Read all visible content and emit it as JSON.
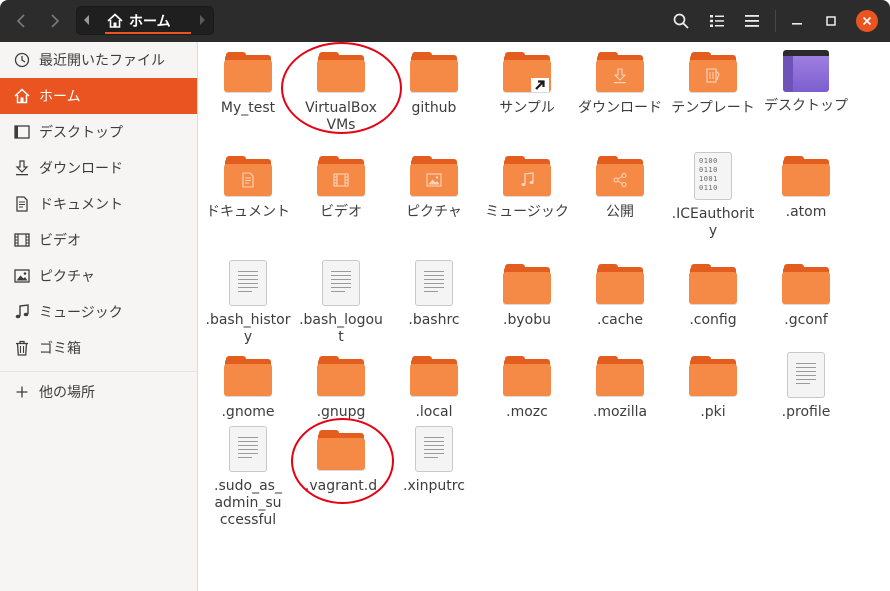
{
  "header": {
    "back_icon": "chevron-left-icon",
    "forward_icon": "chevron-right-icon",
    "path_current": "ホーム",
    "search_icon": "search-icon",
    "view_icon": "list-view-icon",
    "menu_icon": "hamburger-menu-icon",
    "accent_color": "#e95420"
  },
  "sidebar": {
    "items": [
      {
        "label": "最近開いたファイル",
        "icon": "clock-icon"
      },
      {
        "label": "ホーム",
        "icon": "home-icon",
        "active": true
      },
      {
        "label": "デスクトップ",
        "icon": "desktop-icon"
      },
      {
        "label": "ダウンロード",
        "icon": "download-icon"
      },
      {
        "label": "ドキュメント",
        "icon": "document-icon"
      },
      {
        "label": "ビデオ",
        "icon": "video-icon"
      },
      {
        "label": "ピクチャ",
        "icon": "picture-icon"
      },
      {
        "label": "ミュージック",
        "icon": "music-icon"
      },
      {
        "label": "ゴミ箱",
        "icon": "trash-icon"
      },
      {
        "label": "他の場所",
        "icon": "plus-icon"
      }
    ]
  },
  "files": [
    {
      "name": "My_test",
      "type": "folder"
    },
    {
      "name": "VirtualBox VMs",
      "type": "folder"
    },
    {
      "name": "github",
      "type": "folder"
    },
    {
      "name": "サンプル",
      "type": "folder-link"
    },
    {
      "name": "ダウンロード",
      "type": "folder-download"
    },
    {
      "name": "テンプレート",
      "type": "folder-template"
    },
    {
      "name": "デスクトップ",
      "type": "desktop"
    },
    {
      "name": "ドキュメント",
      "type": "folder-document"
    },
    {
      "name": "ビデオ",
      "type": "folder-video"
    },
    {
      "name": "ピクチャ",
      "type": "folder-picture"
    },
    {
      "name": "ミュージック",
      "type": "folder-music"
    },
    {
      "name": "公開",
      "type": "folder-share"
    },
    {
      "name": ".ICEauthority",
      "type": "binary"
    },
    {
      "name": ".atom",
      "type": "folder"
    },
    {
      "name": ".bash_history",
      "type": "text"
    },
    {
      "name": ".bash_logout",
      "type": "text"
    },
    {
      "name": ".bashrc",
      "type": "text"
    },
    {
      "name": ".byobu",
      "type": "folder"
    },
    {
      "name": ".cache",
      "type": "folder"
    },
    {
      "name": ".config",
      "type": "folder"
    },
    {
      "name": ".gconf",
      "type": "folder"
    },
    {
      "name": ".gnome",
      "type": "folder"
    },
    {
      "name": ".gnupg",
      "type": "folder"
    },
    {
      "name": ".local",
      "type": "folder"
    },
    {
      "name": ".mozc",
      "type": "folder"
    },
    {
      "name": ".mozilla",
      "type": "folder"
    },
    {
      "name": ".pki",
      "type": "folder"
    },
    {
      "name": ".profile",
      "type": "text"
    },
    {
      "name": ".sudo_as_admin_successful",
      "type": "text"
    },
    {
      "name": ".vagrant.d",
      "type": "folder"
    },
    {
      "name": ".xinputrc",
      "type": "text"
    }
  ],
  "binary_icon_text": [
    "0100",
    "0110",
    "1001",
    "0110"
  ],
  "annotation_color": "#e60012"
}
